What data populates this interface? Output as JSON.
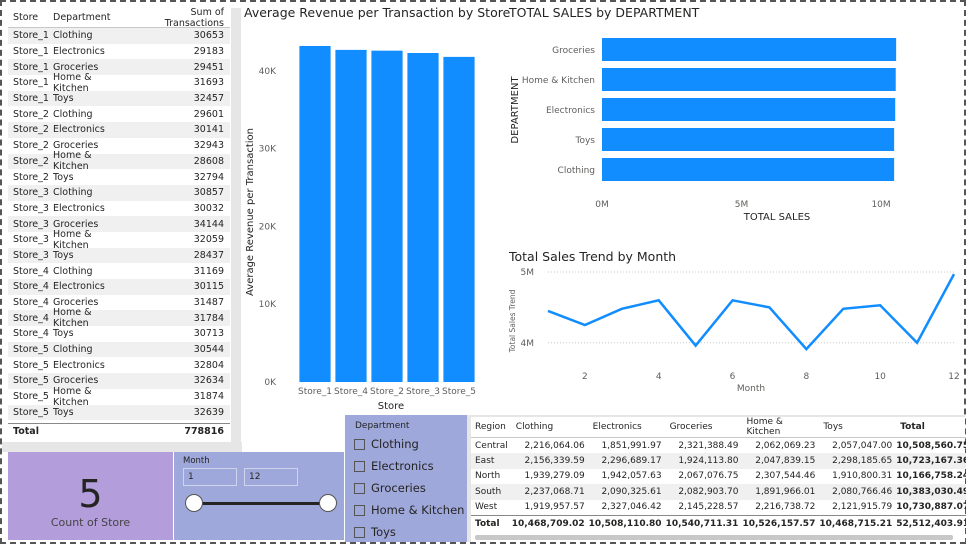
{
  "store_table": {
    "headers": [
      "Store",
      "Department",
      "Sum of Transactions"
    ],
    "rows": [
      [
        "Store_1",
        "Clothing",
        "30653"
      ],
      [
        "Store_1",
        "Electronics",
        "29183"
      ],
      [
        "Store_1",
        "Groceries",
        "29451"
      ],
      [
        "Store_1",
        "Home & Kitchen",
        "31693"
      ],
      [
        "Store_1",
        "Toys",
        "32457"
      ],
      [
        "Store_2",
        "Clothing",
        "29601"
      ],
      [
        "Store_2",
        "Electronics",
        "30141"
      ],
      [
        "Store_2",
        "Groceries",
        "32943"
      ],
      [
        "Store_2",
        "Home & Kitchen",
        "28608"
      ],
      [
        "Store_2",
        "Toys",
        "32794"
      ],
      [
        "Store_3",
        "Clothing",
        "30857"
      ],
      [
        "Store_3",
        "Electronics",
        "30032"
      ],
      [
        "Store_3",
        "Groceries",
        "34144"
      ],
      [
        "Store_3",
        "Home & Kitchen",
        "32059"
      ],
      [
        "Store_3",
        "Toys",
        "28437"
      ],
      [
        "Store_4",
        "Clothing",
        "31169"
      ],
      [
        "Store_4",
        "Electronics",
        "30115"
      ],
      [
        "Store_4",
        "Groceries",
        "31487"
      ],
      [
        "Store_4",
        "Home & Kitchen",
        "31784"
      ],
      [
        "Store_4",
        "Toys",
        "30713"
      ],
      [
        "Store_5",
        "Clothing",
        "30544"
      ],
      [
        "Store_5",
        "Electronics",
        "32804"
      ],
      [
        "Store_5",
        "Groceries",
        "32634"
      ],
      [
        "Store_5",
        "Home & Kitchen",
        "31874"
      ],
      [
        "Store_5",
        "Toys",
        "32639"
      ]
    ],
    "total_label": "Total",
    "total_value": "778816"
  },
  "avg_chart": {
    "title": "Average Revenue per Transaction by Store",
    "xlabel": "Store",
    "ylabel": "Average Revenue per Transaction",
    "ticks": [
      "0K",
      "10K",
      "20K",
      "30K",
      "40K"
    ]
  },
  "dept_chart": {
    "title": "TOTAL SALES by DEPARTMENT",
    "xlabel": "TOTAL SALES",
    "ylabel": "DEPARTMENT",
    "ticks": [
      "0M",
      "5M",
      "10M"
    ]
  },
  "trend_chart": {
    "title": "Total Sales Trend by Month",
    "xlabel": "Month",
    "ylabel": "Total Sales Trend",
    "yticks": [
      "4M",
      "5M"
    ],
    "xticks": [
      "2",
      "4",
      "6",
      "8",
      "10",
      "12"
    ]
  },
  "chart_data": [
    {
      "type": "bar",
      "title": "Average Revenue per Transaction by Store",
      "xlabel": "Store",
      "ylabel": "Average Revenue per Transaction",
      "categories": [
        "Store_1",
        "Store_4",
        "Store_2",
        "Store_3",
        "Store_5"
      ],
      "values": [
        43200,
        42700,
        42600,
        42300,
        41800
      ],
      "ylim": [
        0,
        45000
      ],
      "color": "#118dff"
    },
    {
      "type": "bar",
      "orientation": "horizontal",
      "title": "TOTAL SALES by DEPARTMENT",
      "xlabel": "TOTAL SALES",
      "ylabel": "DEPARTMENT",
      "categories": [
        "Groceries",
        "Home & Kitchen",
        "Electronics",
        "Toys",
        "Clothing"
      ],
      "values": [
        10540711.31,
        10526157.57,
        10508110.8,
        10468715.21,
        10468709.02
      ],
      "xlim": [
        0,
        10500000
      ],
      "color": "#118dff"
    },
    {
      "type": "line",
      "title": "Total Sales Trend by Month",
      "xlabel": "Month",
      "ylabel": "Total Sales Trend",
      "x": [
        1,
        2,
        3,
        4,
        5,
        6,
        7,
        8,
        9,
        10,
        11,
        12
      ],
      "y": [
        4450000,
        4250000,
        4480000,
        4600000,
        3960000,
        4600000,
        4500000,
        3910000,
        4480000,
        4530000,
        4000000,
        4970000
      ],
      "ylim": [
        3700000,
        5000000
      ],
      "color": "#118dff"
    }
  ],
  "card": {
    "value": "5",
    "label": "Count of Store"
  },
  "month_slicer": {
    "title": "Month",
    "from": "1",
    "to": "12"
  },
  "dept_slicer": {
    "title": "Department",
    "options": [
      "Clothing",
      "Electronics",
      "Groceries",
      "Home & Kitchen",
      "Toys"
    ]
  },
  "matrix": {
    "headers": [
      "Region",
      "Clothing",
      "Electronics",
      "Groceries",
      "Home & Kitchen",
      "Toys",
      "Total"
    ],
    "rows": [
      [
        "Central",
        "2,216,064.06",
        "1,851,991.97",
        "2,321,388.49",
        "2,062,069.23",
        "2,057,047.00",
        "10,508,560.75"
      ],
      [
        "East",
        "2,156,339.59",
        "2,296,689.17",
        "1,924,113.80",
        "2,047,839.15",
        "2,298,185.65",
        "10,723,167.36"
      ],
      [
        "North",
        "1,939,279.09",
        "1,942,057.63",
        "2,067,076.75",
        "2,307,544.46",
        "1,910,800.31",
        "10,166,758.24"
      ],
      [
        "South",
        "2,237,068.71",
        "2,090,325.61",
        "2,082,903.70",
        "1,891,966.01",
        "2,080,766.46",
        "10,383,030.49"
      ],
      [
        "West",
        "1,919,957.57",
        "2,327,046.42",
        "2,145,228.57",
        "2,216,738.72",
        "2,121,915.79",
        "10,730,887.07"
      ]
    ],
    "total": [
      "Total",
      "10,468,709.02",
      "10,508,110.80",
      "10,540,711.31",
      "10,526,157.57",
      "10,468,715.21",
      "52,512,403.91"
    ]
  }
}
